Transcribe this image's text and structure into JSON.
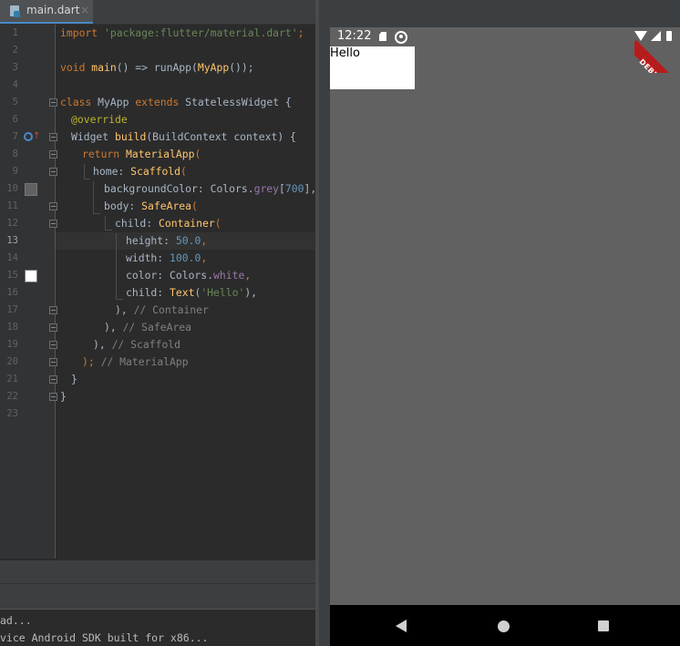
{
  "ide": {
    "tab": {
      "label": "main.dart",
      "close": "×"
    },
    "line_numbers": [
      "1",
      "2",
      "3",
      "4",
      "5",
      "6",
      "7",
      "8",
      "9",
      "10",
      "11",
      "12",
      "13",
      "14",
      "15",
      "16",
      "17",
      "18",
      "19",
      "20",
      "21",
      "22",
      "23"
    ],
    "code": {
      "l1_import": "import",
      "l1_pkg": "'package:flutter/material.dart'",
      "l1_semi": ";",
      "l3_void": "void",
      "l3_main": "main",
      "l3_rest": "() => runApp(",
      "l3_myapp": "MyApp",
      "l3_end": "());",
      "l5_class": "class",
      "l5_name": " MyApp ",
      "l5_extends": "extends",
      "l5_rest": " StatelessWidget {",
      "l6": "@override",
      "l7_widget": "Widget ",
      "l7_build": "build",
      "l7_rest": "(BuildContext context) {",
      "l8_return": "return ",
      "l8_mat": "MaterialApp",
      "l8_paren": "(",
      "l9_home": "home: ",
      "l9_scaffold": "Scaffold",
      "l9_paren": "(",
      "l10_bg": "backgroundColor: Colors.",
      "l10_grey": "grey",
      "l10_open": "[",
      "l10_num": "700",
      "l10_close": "],",
      "l11_body": "body: ",
      "l11_safe": "SafeArea",
      "l11_paren": "(",
      "l12_child": "child: ",
      "l12_container": "Container",
      "l12_paren": "(",
      "l13_height": "height: ",
      "l13_num": "50.0",
      "l13_comma": ",",
      "l14_width": "width: ",
      "l14_num": "100.0",
      "l14_comma": ",",
      "l15_color": "color: Colors.",
      "l15_white": "white",
      "l15_comma": ",",
      "l16_child": "child: ",
      "l16_text": "Text",
      "l16_open": "(",
      "l16_str": "'Hello'",
      "l16_close": "),",
      "l17_close": "), ",
      "l17_com": "// Container",
      "l18_close": "), ",
      "l18_com": "// SafeArea",
      "l19_close": "), ",
      "l19_com": "// Scaffold",
      "l20_close": ");",
      "l20_com": " // MaterialApp",
      "l21": "}",
      "l22": "}"
    },
    "swatch_colors": {
      "grey700": "#616161",
      "white": "#ffffff"
    },
    "console": {
      "line1": "ad...",
      "line2": "vice Android SDK built for x86..."
    }
  },
  "emulator": {
    "status_time": "12:22",
    "debug_label": "DEBUG",
    "hello_text": "Hello",
    "screen_bg": "#616161",
    "container_color": "#ffffff"
  }
}
